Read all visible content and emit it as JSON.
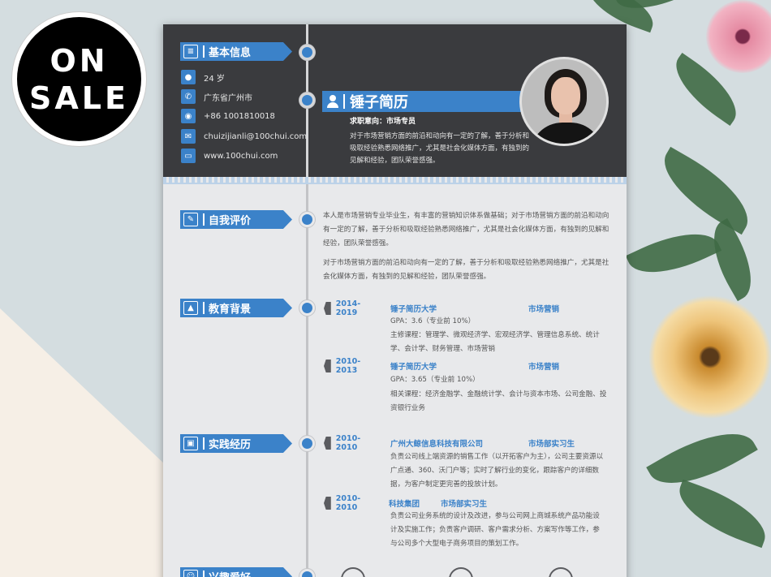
{
  "badge": {
    "line1": "ON",
    "line2": "SALE"
  },
  "sidebar": {
    "section_basic": "基本信息",
    "info": [
      {
        "icon": "person-icon",
        "text": "24 岁"
      },
      {
        "icon": "phone-icon",
        "text": "广东省广州市"
      },
      {
        "icon": "location-icon",
        "text": "+86 1001810018"
      },
      {
        "icon": "mail-icon",
        "text": "chuizijianli@100chui.com"
      },
      {
        "icon": "web-icon",
        "text": "www.100chui.com"
      }
    ]
  },
  "header": {
    "name": "锤子简历",
    "job": "求职意向：市场专员",
    "intro": "对于市场营销方面的前沿和动向有一定的了解，善于分析和吸取经验熟悉网络推广，尤其是社会化媒体方面，有独到的见解和经验，团队荣誉感强。"
  },
  "sections": {
    "self": "自我评价",
    "edu": "教育背景",
    "work": "实践经历",
    "hobby": "兴趣爱好"
  },
  "self_eval": {
    "p1": "本人是市场营销专业毕业生，有丰富的营销知识体系做基础；对于市场营销方面的前沿和动向有一定的了解，善于分析和吸取经验熟悉网络推广，尤其是社会化媒体方面，有独到的见解和经验，团队荣誉感强。",
    "p2": "对于市场营销方面的前沿和动向有一定的了解，善于分析和吸取经验熟悉网络推广，尤其是社会化媒体方面，有独到的见解和经验，团队荣誉感强。"
  },
  "education": [
    {
      "period": "2014-2019",
      "school": "锤子简历大学",
      "major": "市场营销",
      "gpa": "GPA：3.6（专业前 10%）",
      "courses": "主修课程：管理学、微观经济学、宏观经济学、管理信息系统、统计学、会计学、财务管理、市场营销"
    },
    {
      "period": "2010-2013",
      "school": "锤子简历大学",
      "major": "市场营销",
      "gpa": "GPA：3.65（专业前 10%）",
      "courses": "相关课程：经济金融学、金融统计学、会计与资本市场、公司金融、投资银行业务"
    }
  ],
  "work": [
    {
      "period": "2010-2010",
      "company": "广州大鲸信息科技有限公司",
      "role": "市场部实习生",
      "desc": "负责公司线上端资源的销售工作（以开拓客户为主），公司主要资源以广点通、360、沃门户等；实时了解行业的变化，跟踪客户的详细数据，为客户制定更完善的投放计划。"
    },
    {
      "period": "2010-2010",
      "company": "科技集团",
      "role": "市场部实习生",
      "desc": "负责公司业务系统的设计及改进，参与公司网上商城系统产品功能设计及实施工作；负责客户调研、客户需求分析、方案写作等工作，参与公司多个大型电子商务项目的策划工作。"
    }
  ]
}
